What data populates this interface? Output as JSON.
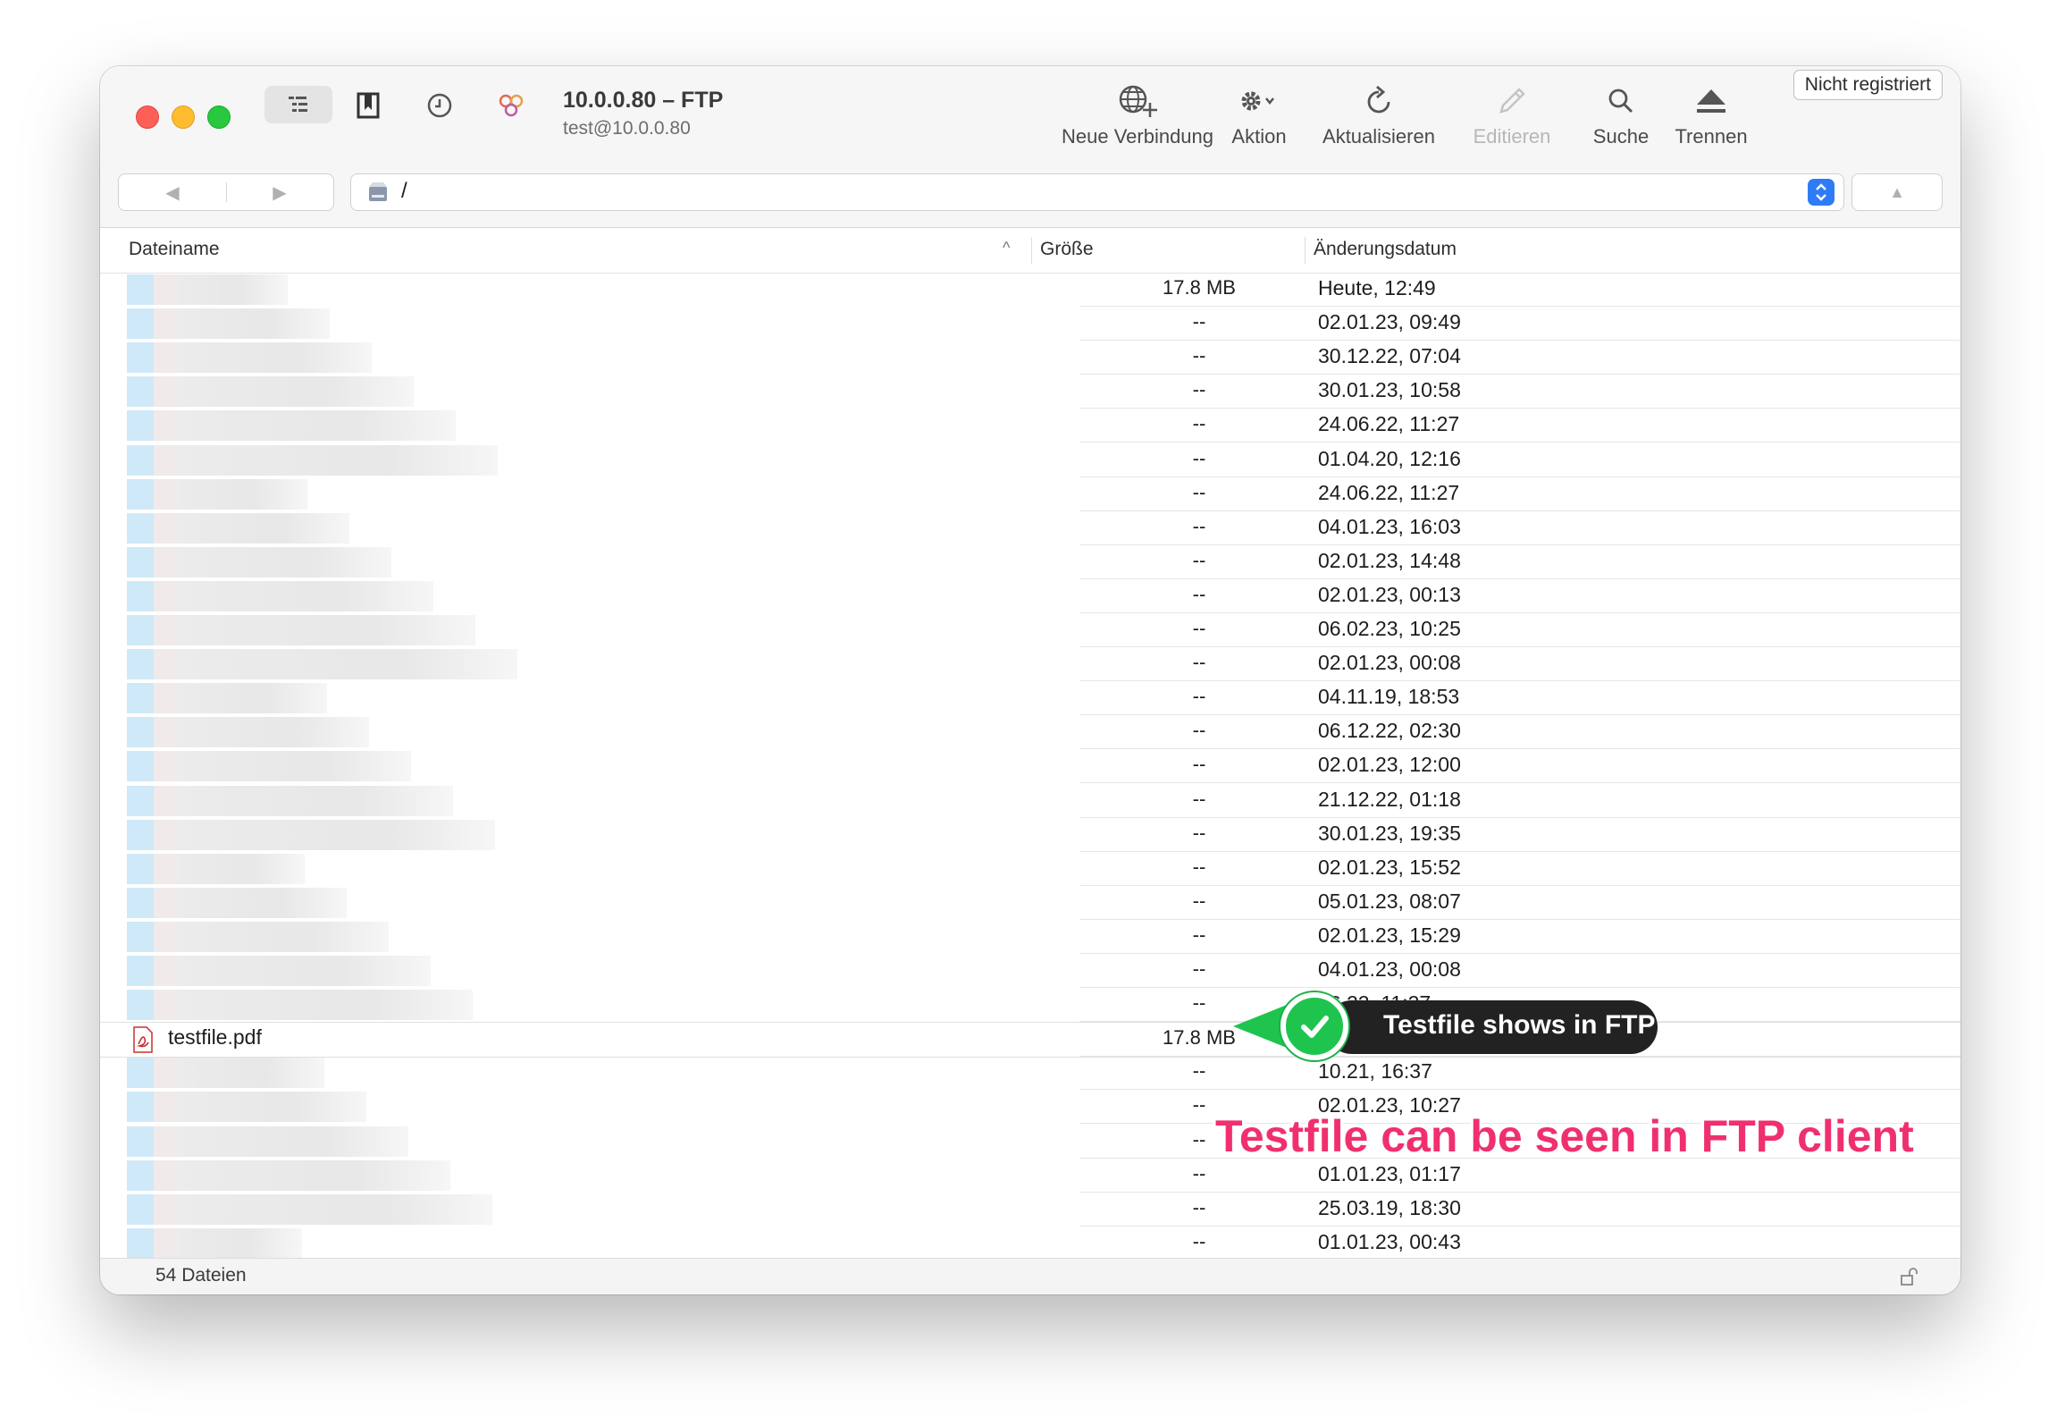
{
  "window": {
    "title": "10.0.0.80 – FTP",
    "subtitle": "test@10.0.0.80",
    "register_label": "Nicht registriert"
  },
  "toolbar": {
    "new_connection": "Neue Verbindung",
    "action": "Aktion",
    "refresh": "Aktualisieren",
    "edit": "Editieren",
    "search": "Suche",
    "disconnect": "Trennen"
  },
  "pathbar": {
    "path": "/"
  },
  "columns": {
    "name": "Dateiname",
    "size": "Größe",
    "date": "Änderungsdatum"
  },
  "rows": [
    {
      "size": "17.8 MB",
      "date": "Heute, 12:49"
    },
    {
      "size": "--",
      "date": "02.01.23, 09:49"
    },
    {
      "size": "--",
      "date": "30.12.22, 07:04"
    },
    {
      "size": "--",
      "date": "30.01.23, 10:58"
    },
    {
      "size": "--",
      "date": "24.06.22, 11:27"
    },
    {
      "size": "--",
      "date": "01.04.20, 12:16"
    },
    {
      "size": "--",
      "date": "24.06.22, 11:27"
    },
    {
      "size": "--",
      "date": "04.01.23, 16:03"
    },
    {
      "size": "--",
      "date": "02.01.23, 14:48"
    },
    {
      "size": "--",
      "date": "02.01.23, 00:13"
    },
    {
      "size": "--",
      "date": "06.02.23, 10:25"
    },
    {
      "size": "--",
      "date": "02.01.23, 00:08"
    },
    {
      "size": "--",
      "date": "04.11.19, 18:53"
    },
    {
      "size": "--",
      "date": "06.12.22, 02:30"
    },
    {
      "size": "--",
      "date": "02.01.23, 12:00"
    },
    {
      "size": "--",
      "date": "21.12.22, 01:18"
    },
    {
      "size": "--",
      "date": "30.01.23, 19:35"
    },
    {
      "size": "--",
      "date": "02.01.23, 15:52"
    },
    {
      "size": "--",
      "date": "05.01.23, 08:07"
    },
    {
      "size": "--",
      "date": "02.01.23, 15:29"
    },
    {
      "size": "--",
      "date": "04.01.23, 00:08"
    },
    {
      "size": "--",
      "date": "06.22, 11:27"
    },
    {
      "name": "testfile.pdf",
      "size": "17.8 MB",
      "date": ""
    },
    {
      "size": "--",
      "date": "10.21, 16:37"
    },
    {
      "size": "--",
      "date": "02.01.23, 10:27"
    },
    {
      "size": "--",
      "date": ""
    },
    {
      "size": "--",
      "date": "01.01.23, 01:17"
    },
    {
      "size": "--",
      "date": "25.03.19, 18:30"
    },
    {
      "size": "--",
      "date": "01.01.23, 00:43"
    }
  ],
  "status": {
    "file_count": "54 Dateien"
  },
  "annotations": {
    "callout": "Testfile shows in FTP",
    "caption": "Testfile can be seen in FTP client",
    "callout_color": "#1fc44e",
    "caption_color": "#f0306e"
  }
}
